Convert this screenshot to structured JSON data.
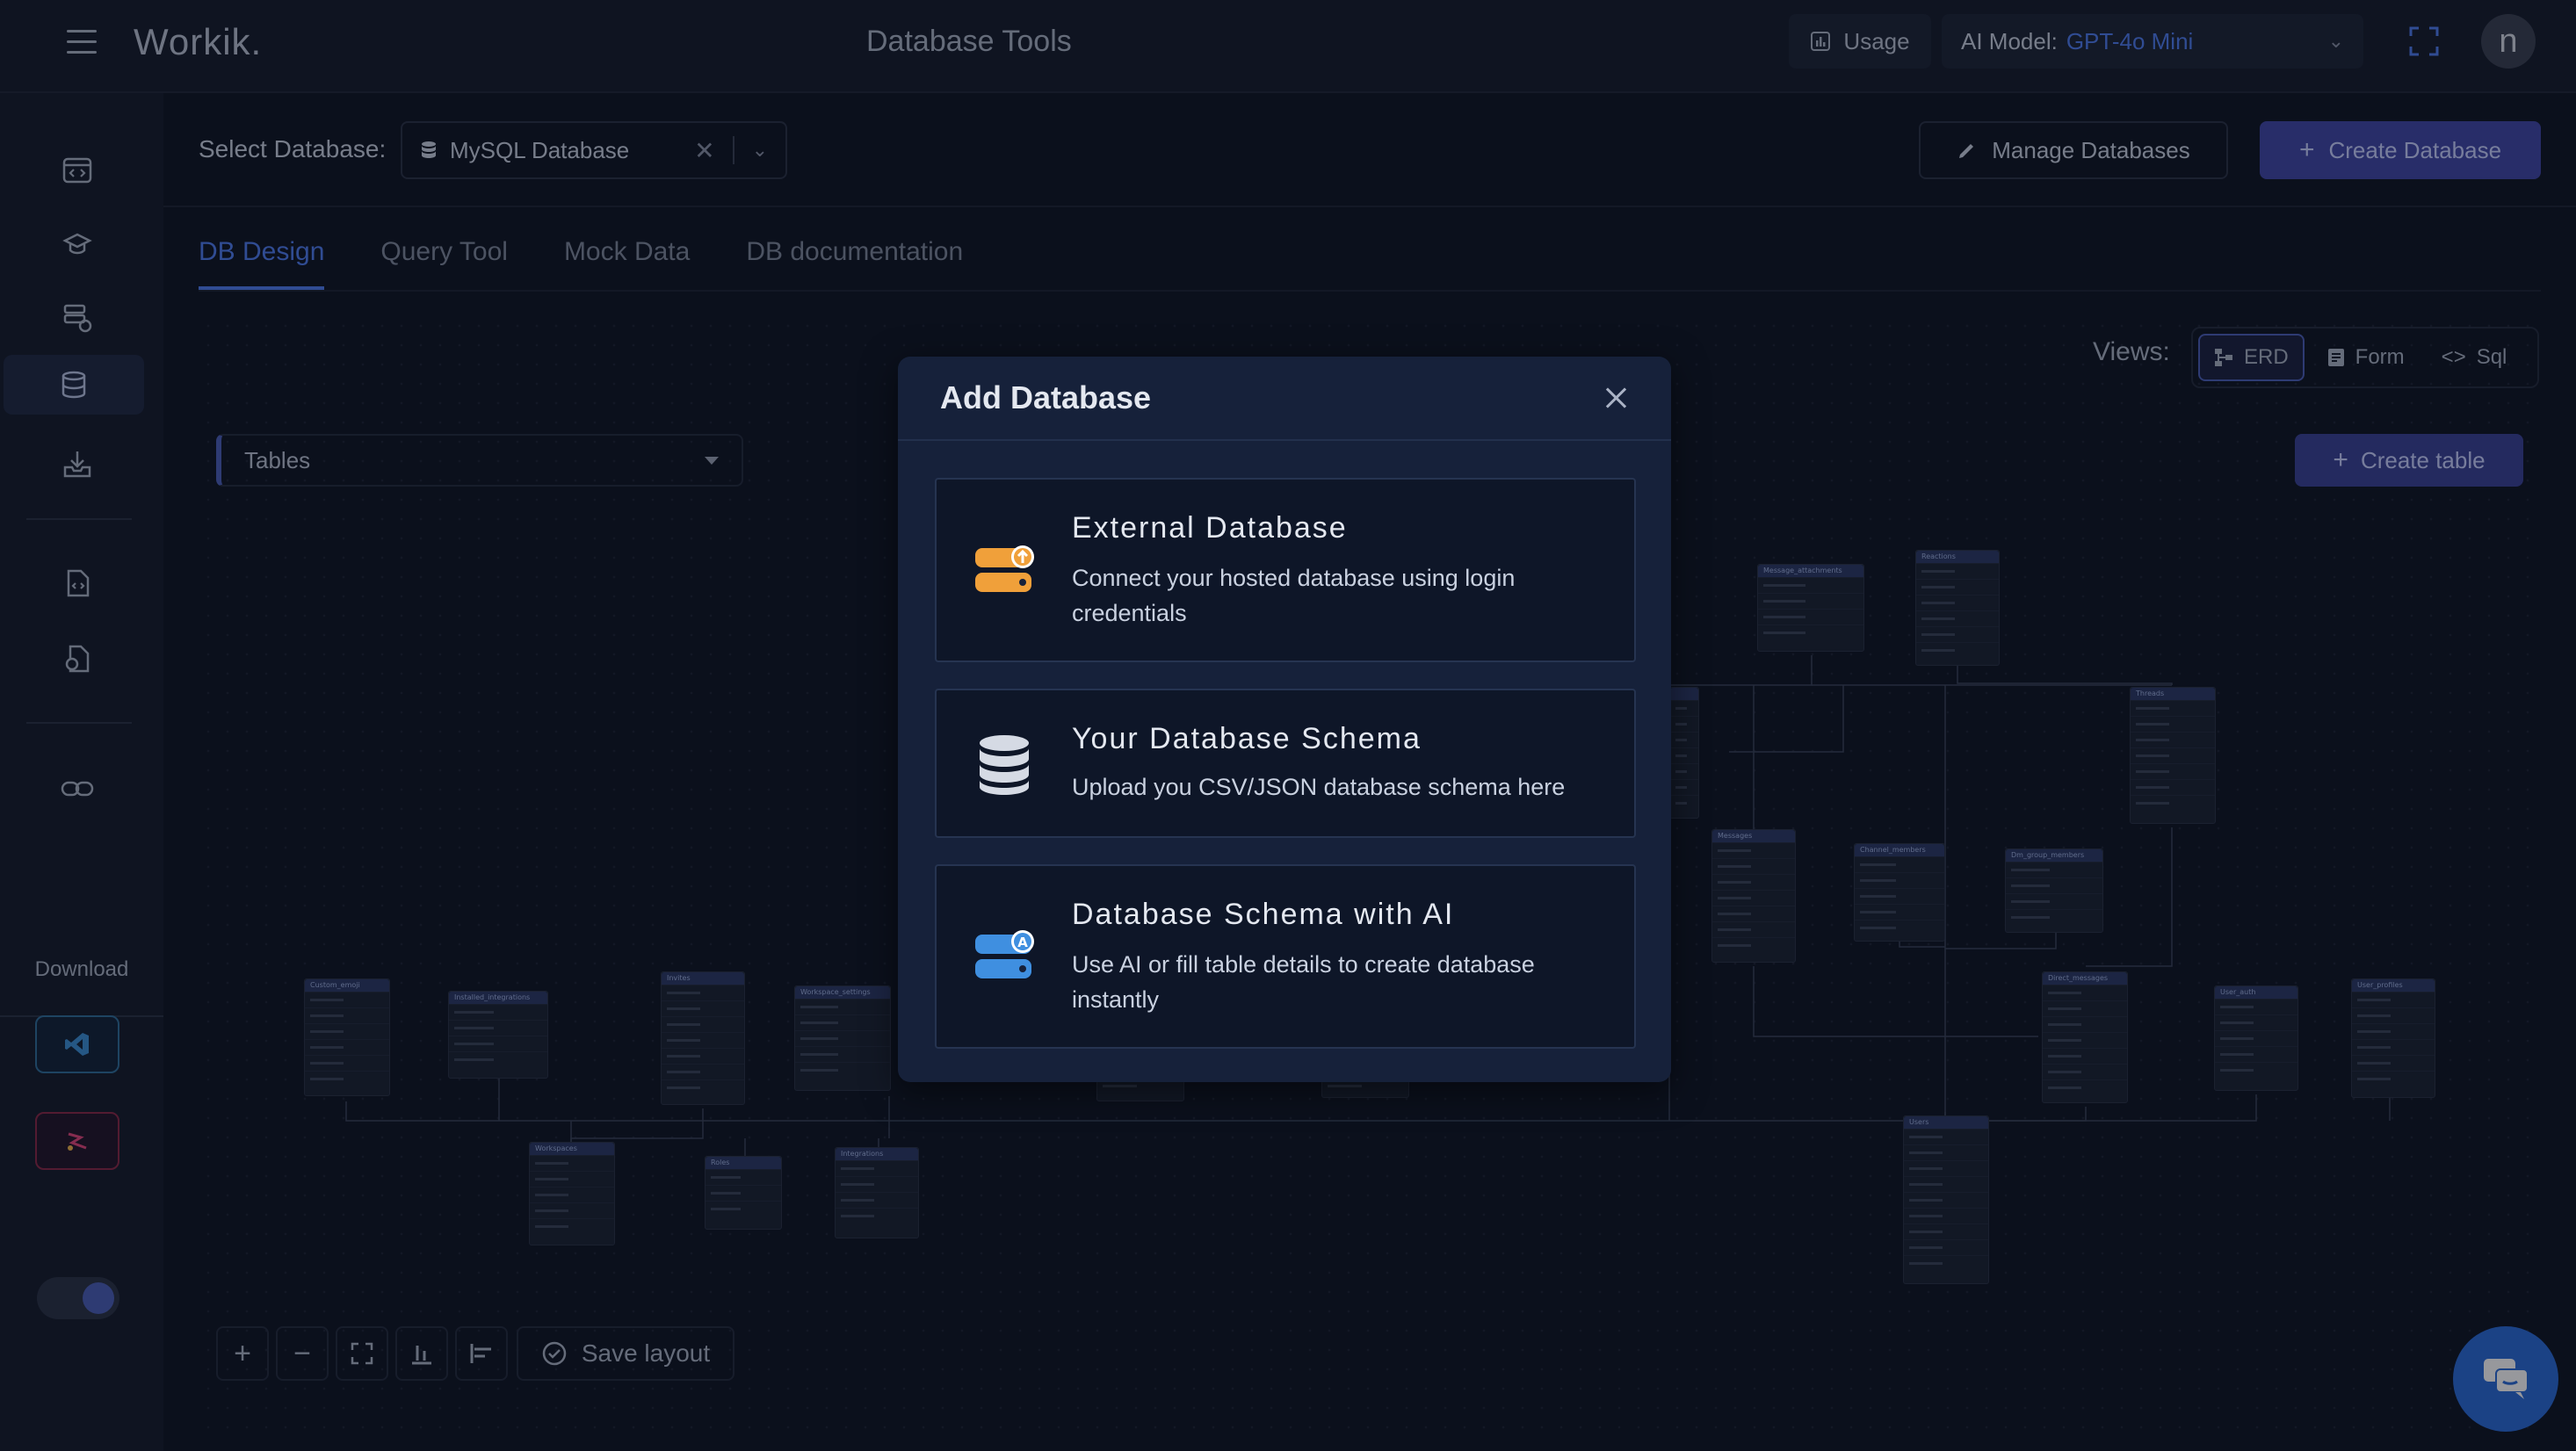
{
  "topbar": {
    "logo": "Workik.",
    "title": "Database Tools",
    "usage_label": "Usage",
    "model_label": "AI Model:",
    "model_value": "GPT-4o Mini",
    "avatar_initial": "n"
  },
  "sidebar": {
    "items": [
      "code-editor-icon",
      "ai-agent-icon",
      "database-user-icon",
      "database-icon",
      "download-tray-icon",
      "doc-code-icon",
      "doc-settings-icon",
      "link-icon"
    ],
    "download_label": "Download"
  },
  "db_bar": {
    "select_label": "Select Database:",
    "selected_value": "MySQL Database",
    "manage_label": "Manage Databases",
    "create_label": "Create Database"
  },
  "tabs": [
    {
      "label": "DB Design",
      "active": true
    },
    {
      "label": "Query Tool",
      "active": false
    },
    {
      "label": "Mock Data",
      "active": false
    },
    {
      "label": "DB documentation",
      "active": false
    }
  ],
  "views": {
    "label": "Views:",
    "options": [
      "ERD",
      "Form",
      "Sql"
    ],
    "active": "ERD"
  },
  "tables_select": {
    "value": "Tables"
  },
  "create_table_label": "Create table",
  "erd_tables": [
    "Custom_emoji",
    "Installed_integrations",
    "Invites",
    "Workspace_settings",
    "Workspaces",
    "Roles",
    "Integrations",
    "Message_attachments",
    "Reactions",
    "Threads",
    "Messages",
    "Channel_members",
    "Dm_group_members",
    "Direct_messages",
    "User_auth",
    "User_profiles",
    "Users"
  ],
  "bottom": {
    "save_layout_label": "Save layout"
  },
  "modal": {
    "title": "Add Database",
    "options": [
      {
        "title": "External Database",
        "description": "Connect your hosted database using login credentials",
        "icon": "server-upload-icon"
      },
      {
        "title": "Your Database Schema",
        "description": "Upload you CSV/JSON database schema here",
        "icon": "database-stack-icon"
      },
      {
        "title": "Database Schema with AI",
        "description": "Use AI or fill table details to create database instantly",
        "icon": "server-ai-icon"
      }
    ]
  },
  "colors": {
    "accent": "#4f7cf0",
    "primary_button": "#4048a8",
    "background": "#0f1524",
    "modal_bg": "#16213a"
  }
}
